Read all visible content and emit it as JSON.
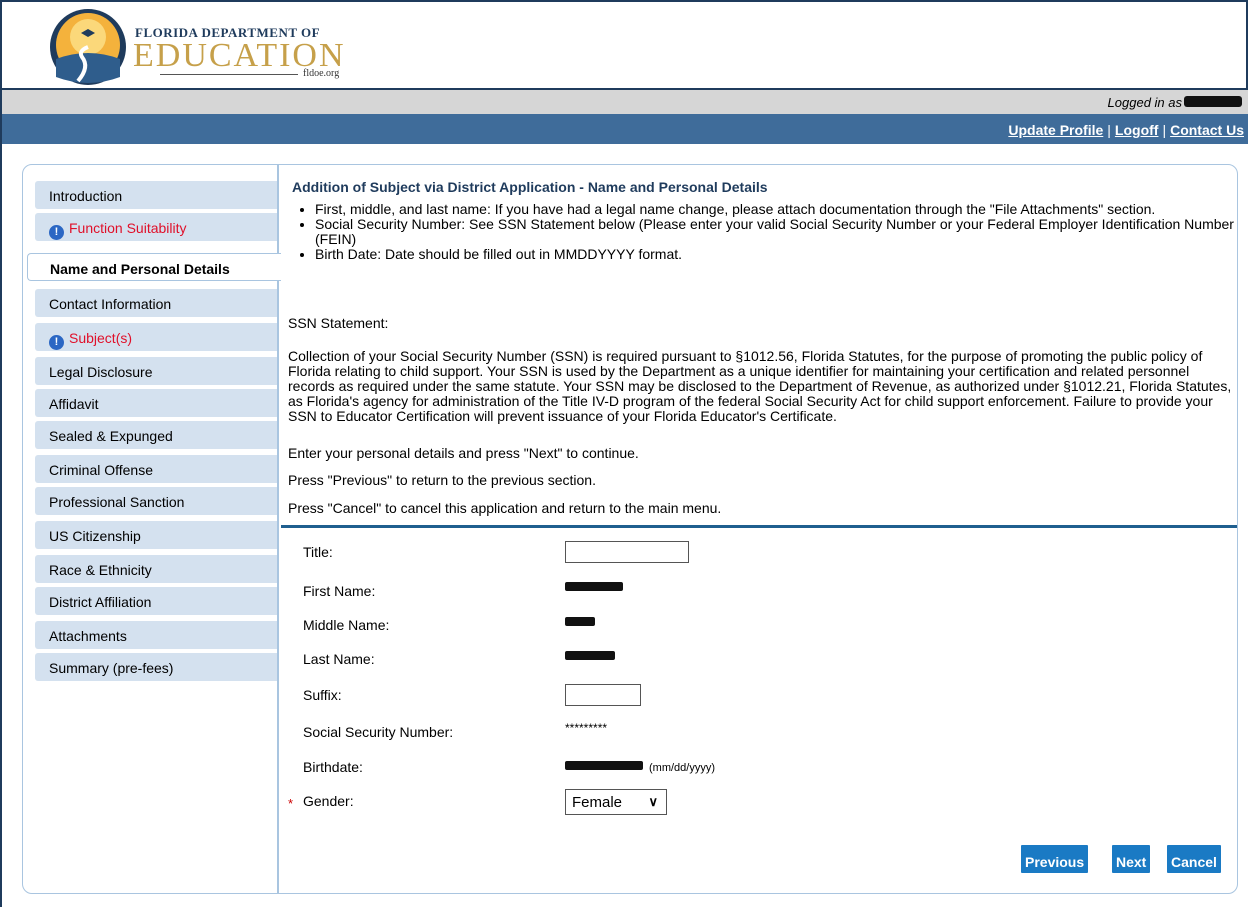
{
  "header": {
    "org_small": "FLORIDA DEPARTMENT OF",
    "org_big": "EDUCATION",
    "site": "fldoe.org",
    "logged_in_label": "Logged in as"
  },
  "top_links": [
    "Update Profile",
    "Logoff",
    "Contact Us"
  ],
  "sidebar": {
    "items": [
      {
        "label": "Introduction",
        "state": "normal"
      },
      {
        "label": "Function Suitability",
        "state": "alert"
      },
      {
        "label": "Name and Personal Details",
        "state": "active"
      },
      {
        "label": "Contact Information",
        "state": "normal"
      },
      {
        "label": "Subject(s)",
        "state": "alert"
      },
      {
        "label": "Legal Disclosure",
        "state": "normal"
      },
      {
        "label": "Affidavit",
        "state": "normal"
      },
      {
        "label": "Sealed & Expunged",
        "state": "normal"
      },
      {
        "label": "Criminal Offense",
        "state": "normal"
      },
      {
        "label": "Professional Sanction",
        "state": "normal"
      },
      {
        "label": "US Citizenship",
        "state": "normal"
      },
      {
        "label": "Race & Ethnicity",
        "state": "normal"
      },
      {
        "label": "District Affiliation",
        "state": "normal"
      },
      {
        "label": "Attachments",
        "state": "normal"
      },
      {
        "label": "Summary (pre-fees)",
        "state": "normal"
      }
    ]
  },
  "main": {
    "title": "Addition of Subject via District Application - Name and Personal Details",
    "bullets": [
      "First, middle, and last name: If you have had a legal name change, please attach documentation through the \"File Attachments\" section.",
      "Social Security Number: See SSN Statement below (Please enter your valid Social Security Number or your Federal Employer Identification Number (FEIN)",
      "Birth Date: Date should be filled out in MMDDYYYY format."
    ],
    "ssn_heading": "SSN Statement:",
    "ssn_statement": "Collection of your Social Security Number (SSN) is required pursuant to §1012.56, Florida Statutes, for the purpose of promoting the public policy of Florida relating to child support. Your SSN is used by the Department as a unique identifier for maintaining your certification and related personnel records as required under the same statute. Your SSN may be disclosed to the Department of Revenue, as authorized under §1012.21, Florida Statutes, as Florida's agency for administration of the Title IV-D program of the federal Social Security Act for child support enforcement. Failure to provide your SSN to Educator Certification will prevent issuance of your Florida Educator's Certificate.",
    "instr_next": "Enter your personal details and press \"Next\" to continue.",
    "instr_prev": "Press \"Previous\" to return to the previous section.",
    "instr_cancel": "Press \"Cancel\" to cancel this application and return to the main menu."
  },
  "form": {
    "title_label": "Title:",
    "title_value": "",
    "first_name_label": "First Name:",
    "middle_name_label": "Middle Name:",
    "last_name_label": "Last Name:",
    "suffix_label": "Suffix:",
    "suffix_value": "",
    "ssn_label": "Social Security Number:",
    "ssn_value": "*********",
    "birthdate_label": "Birthdate:",
    "birthdate_hint": "(mm/dd/yyyy)",
    "gender_required_mark": "*",
    "gender_label": "Gender:",
    "gender_value": "Female"
  },
  "buttons": {
    "previous": "Previous",
    "next": "Next",
    "cancel": "Cancel"
  }
}
